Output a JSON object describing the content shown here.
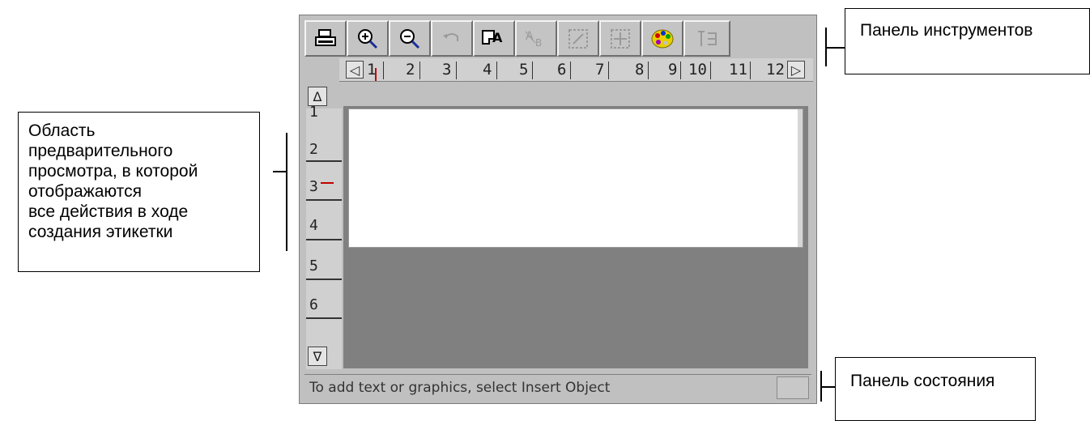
{
  "toolbar": {
    "buttons": [
      {
        "name": "print-button",
        "icon": "printer-icon",
        "enabled": true
      },
      {
        "name": "zoom-in-button",
        "icon": "zoom-in-icon",
        "enabled": true
      },
      {
        "name": "zoom-out-button",
        "icon": "zoom-out-icon",
        "enabled": true
      },
      {
        "name": "undo-button",
        "icon": "undo-icon",
        "enabled": false
      },
      {
        "name": "insert-object-button",
        "icon": "insert-object-icon",
        "enabled": true
      },
      {
        "name": "text-format-button",
        "icon": "text-format-icon",
        "enabled": false
      },
      {
        "name": "resize-button",
        "icon": "resize-icon",
        "enabled": false
      },
      {
        "name": "align-button",
        "icon": "align-icon",
        "enabled": false
      },
      {
        "name": "color-palette-button",
        "icon": "palette-icon",
        "enabled": true
      },
      {
        "name": "extra-button",
        "icon": "grid-icon",
        "enabled": false
      }
    ]
  },
  "hruler": {
    "left_arrow": "◁",
    "right_arrow": "▷",
    "numbers": [
      "1",
      "2",
      "3",
      "4",
      "5",
      "6",
      "7",
      "8",
      "9",
      "10",
      "11",
      "12"
    ]
  },
  "vruler": {
    "up_arrow": "Δ",
    "down_arrow": "∇",
    "numbers": [
      "1",
      "2",
      "3",
      "4",
      "5",
      "6"
    ]
  },
  "status": {
    "text": "To add text or graphics, select Insert Object"
  },
  "callouts": {
    "toolbar": "Панель инструментов",
    "preview": [
      "Область",
      "предварительного",
      "просмотра, в которой",
      "отображаются",
      "все действия в ходе",
      "создания этикетки"
    ],
    "statusbar": "Панель состояния"
  },
  "colors": {
    "window_bg": "#c0c0c0",
    "preview_bg": "#808080",
    "label_bg": "#ffffff",
    "ruler_marker": "#c00000"
  }
}
